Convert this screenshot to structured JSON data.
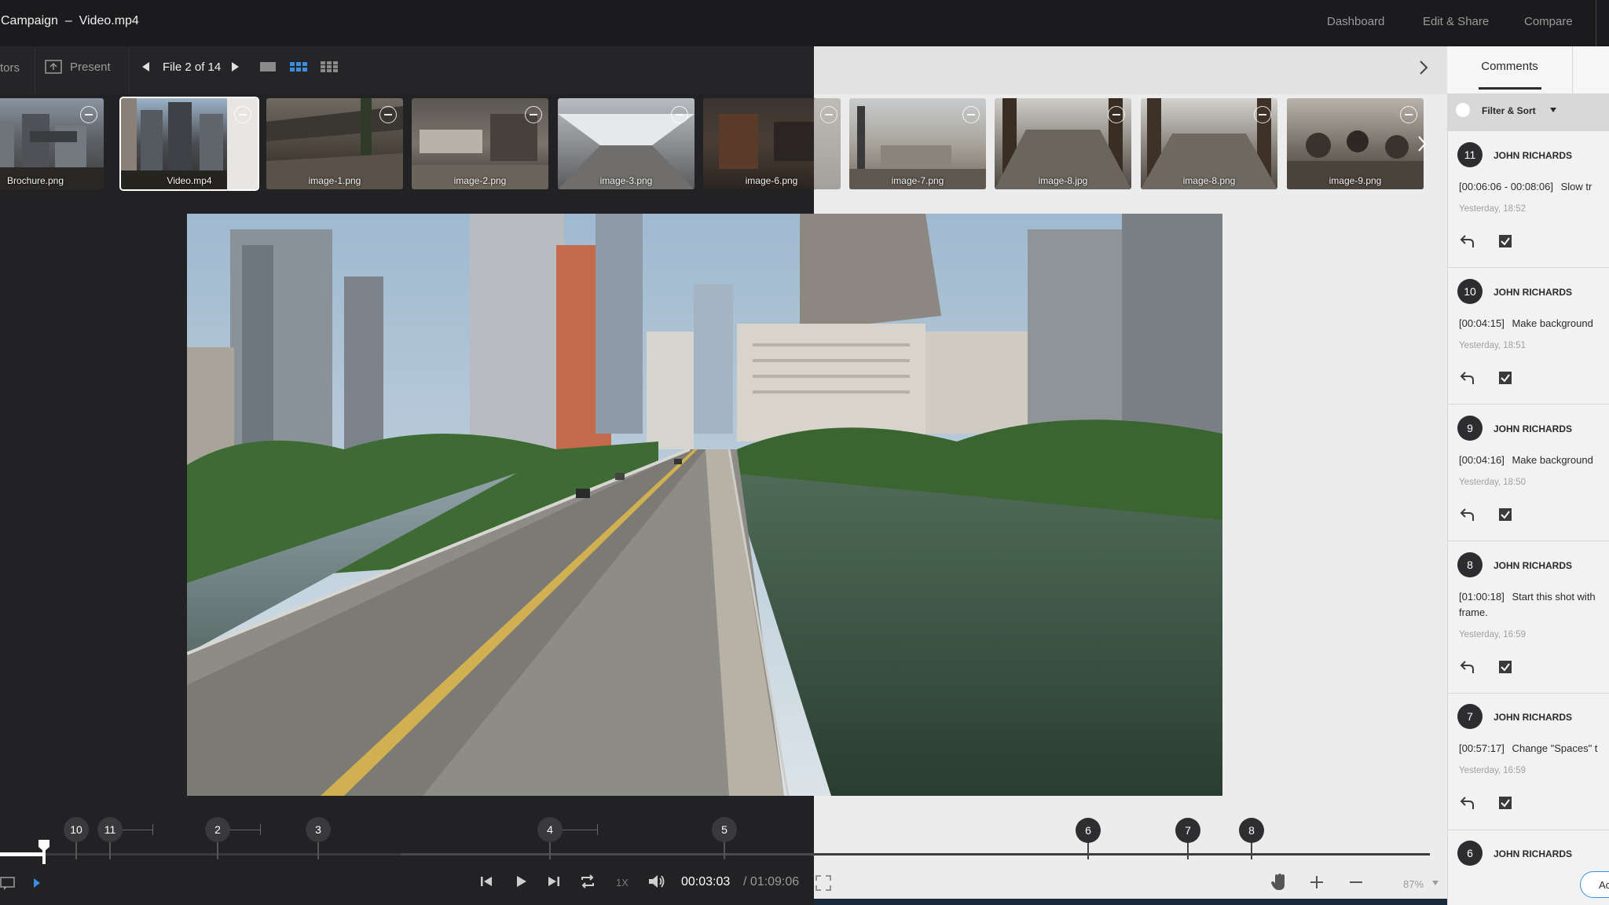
{
  "header": {
    "title": "Campaign  –  Video.mp4",
    "nav": [
      "Dashboard",
      "Edit & Share",
      "Compare"
    ]
  },
  "toolbar": {
    "left_cut_label": "tors",
    "present_label": "Present",
    "file_counter": "File 2 of 14"
  },
  "thumbnails": [
    {
      "label": "Brochure.png",
      "selected": false
    },
    {
      "label": "Video.mp4",
      "selected": true
    },
    {
      "label": "image-1.png",
      "selected": false
    },
    {
      "label": "image-2.png",
      "selected": false
    },
    {
      "label": "image-3.png",
      "selected": false
    },
    {
      "label": "image-6.png",
      "selected": false
    },
    {
      "label": "",
      "selected": false
    },
    {
      "label": "image-7.png",
      "selected": false
    },
    {
      "label": "image-8.jpg",
      "selected": false
    },
    {
      "label": "image-8.png",
      "selected": false
    },
    {
      "label": "image-9.png",
      "selected": false
    }
  ],
  "timeline": {
    "markers": [
      "10",
      "11",
      "2",
      "3",
      "4",
      "5",
      "6",
      "7",
      "8"
    ],
    "progress": 0.04
  },
  "player": {
    "speed": "1X",
    "current_time": "00:03:03",
    "duration": "/ 01:09:06",
    "zoom": "87%"
  },
  "comments_panel": {
    "tab_label": "Comments",
    "filter_label": "Filter & Sort",
    "add_button_label": "Ac",
    "comments": [
      {
        "number": "11",
        "author": "JOHN RICHARDS",
        "timecode": "[00:06:06 - 00:08:06]",
        "text": "Slow tr",
        "text2": "",
        "time": "Yesterday, 18:52"
      },
      {
        "number": "10",
        "author": "JOHN RICHARDS",
        "timecode": "[00:04:15]",
        "text": "Make background",
        "text2": "",
        "time": "Yesterday, 18:51"
      },
      {
        "number": "9",
        "author": "JOHN RICHARDS",
        "timecode": "[00:04:16]",
        "text": "Make background",
        "text2": "",
        "time": "Yesterday, 18:50"
      },
      {
        "number": "8",
        "author": "JOHN RICHARDS",
        "timecode": "[01:00:18]",
        "text": "Start this shot with",
        "text2": "frame.",
        "time": "Yesterday, 16:59"
      },
      {
        "number": "7",
        "author": "JOHN RICHARDS",
        "timecode": "[00:57:17]",
        "text": "Change \"Spaces\" t",
        "text2": "",
        "time": "Yesterday, 16:59"
      },
      {
        "number": "6",
        "author": "JOHN RICHARDS",
        "timecode": "",
        "text": "",
        "text2": "",
        "time": ""
      }
    ]
  }
}
